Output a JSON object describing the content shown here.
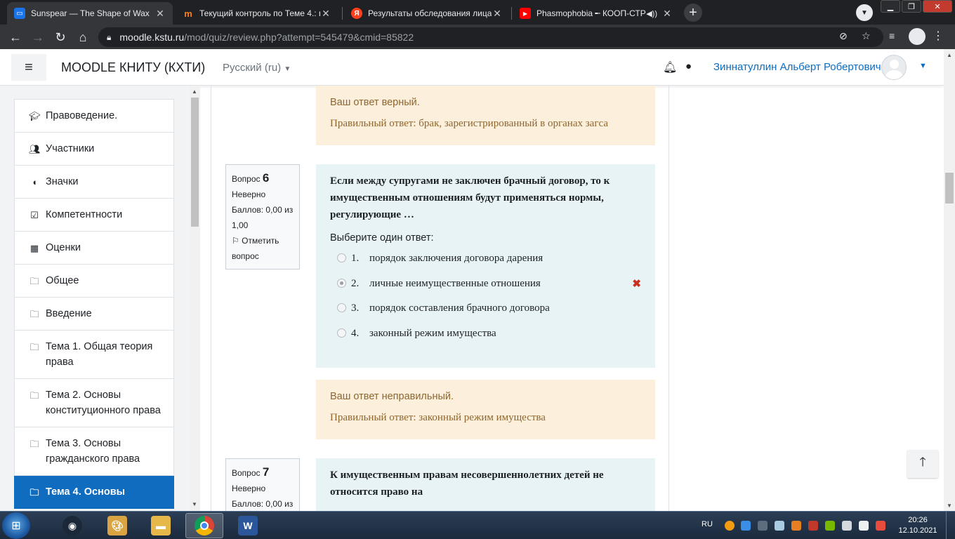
{
  "browser": {
    "tabs": [
      {
        "title": "Sunspear — The Shape of Wax",
        "favicon": "chat-icon",
        "active": true
      },
      {
        "title": "Текущий контроль по Теме 4.: п",
        "favicon": "moodle-icon",
        "active": false
      },
      {
        "title": "Результаты обследования лица,",
        "favicon": "yandex-icon",
        "active": false
      },
      {
        "title": "Phasmophobia ╾ КООП-СТР",
        "favicon": "youtube-icon",
        "active": false
      }
    ],
    "url_host": "moodle.kstu.ru",
    "url_path": "/mod/quiz/review.php?attempt=545479&cmid=85822"
  },
  "navbar": {
    "site_name": "MOODLE КНИТУ (КХТИ)",
    "language": "Русский ‎(ru)‎",
    "user_name": "Зиннатуллин Альберт Робертович"
  },
  "sidebar": {
    "items": [
      {
        "label": "Правоведение.",
        "icon": "graduation-cap-icon"
      },
      {
        "label": "Участники",
        "icon": "users-icon"
      },
      {
        "label": "Значки",
        "icon": "shield-icon"
      },
      {
        "label": "Компетентности",
        "icon": "checkbox-icon"
      },
      {
        "label": "Оценки",
        "icon": "table-icon"
      },
      {
        "label": "Общее",
        "icon": "folder-icon"
      },
      {
        "label": "Введение",
        "icon": "folder-icon"
      },
      {
        "label": "Тема 1. Общая теория права",
        "icon": "folder-icon"
      },
      {
        "label": "Тема 2. Основы конституционного права",
        "icon": "folder-icon"
      },
      {
        "label": "Тема 3. Основы гражданского права",
        "icon": "folder-icon"
      },
      {
        "label": "Тема 4. Основы",
        "icon": "folder-icon",
        "active": true
      }
    ]
  },
  "feedback_prev": {
    "result": "Ваш ответ верный.",
    "correct_label": "Правильный ответ: брак, зарегистрированный в органах загса"
  },
  "q6": {
    "label": "Вопрос",
    "number": "6",
    "state": "Неверно",
    "grade": "Баллов: 0,00 из 1,00",
    "flag": "Отметить вопрос",
    "text": "Если между супругами не заключен брачный договор, то к имущественным отношениям будут применяться нормы, регулирующие …",
    "prompt": "Выберите один ответ:",
    "answers": [
      {
        "num": "1.",
        "text": "порядок заключения договора дарения"
      },
      {
        "num": "2.",
        "text": "личные неимущественные отношения"
      },
      {
        "num": "3.",
        "text": "порядок составления брачного договора"
      },
      {
        "num": "4.",
        "text": "законный режим имущества"
      }
    ],
    "selected": 2,
    "feedback_result": "Ваш ответ неправильный.",
    "feedback_correct": "Правильный ответ: законный режим имущества"
  },
  "q7": {
    "label": "Вопрос",
    "number": "7",
    "state": "Неверно",
    "grade": "Баллов: 0,00 из",
    "text": "К имущественным правам несовершеннолетних детей не относится право на"
  },
  "taskbar": {
    "lang": "RU",
    "time": "20:26",
    "date": "12.10.2021"
  }
}
